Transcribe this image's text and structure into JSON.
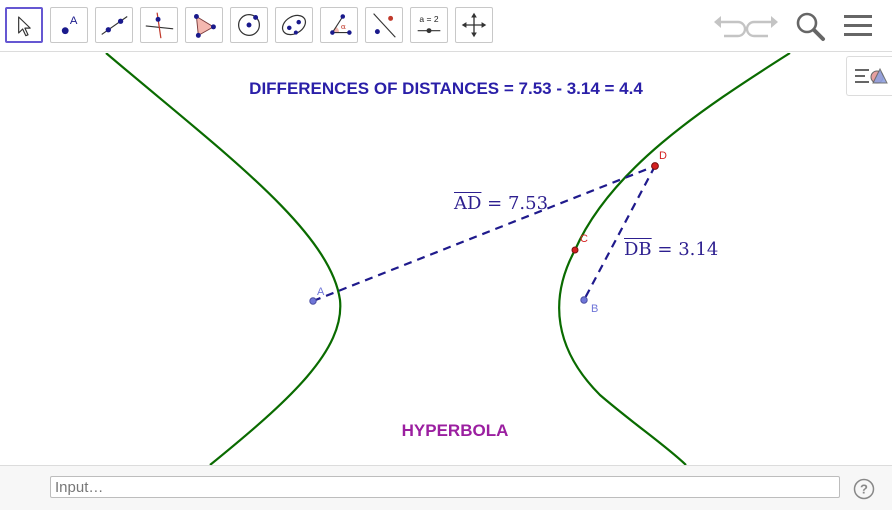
{
  "toolbar": {
    "tools": [
      {
        "name": "move"
      },
      {
        "name": "point",
        "glyph": "A"
      },
      {
        "name": "line"
      },
      {
        "name": "perpendicular-line"
      },
      {
        "name": "polygon"
      },
      {
        "name": "circle-center-point"
      },
      {
        "name": "ellipse"
      },
      {
        "name": "angle",
        "glyph": "α"
      },
      {
        "name": "reflect-about-line"
      },
      {
        "name": "slider",
        "glyph": "a = 2"
      },
      {
        "name": "move-graphics-view"
      }
    ]
  },
  "graphics": {
    "title": "DIFFERENCES OF DISTANCES = 7.53 - 3.14 = 4.4",
    "caption": "HYPERBOLA",
    "measures": {
      "ad": {
        "segment": "AD",
        "value": "= 7.53"
      },
      "db": {
        "segment": "DB",
        "value": "= 3.14"
      }
    },
    "points": {
      "A": "A",
      "B": "B",
      "C": "C",
      "D": "D"
    },
    "colors": {
      "curve": "#0a6b00",
      "dashed": "#1f1a8c",
      "title": "#2a1fa8",
      "caption": "#9b1fa0",
      "focus": "#6f76d8",
      "point_on_curve": "#d42020"
    }
  },
  "input_bar": {
    "placeholder": "Input…",
    "help": "?"
  }
}
